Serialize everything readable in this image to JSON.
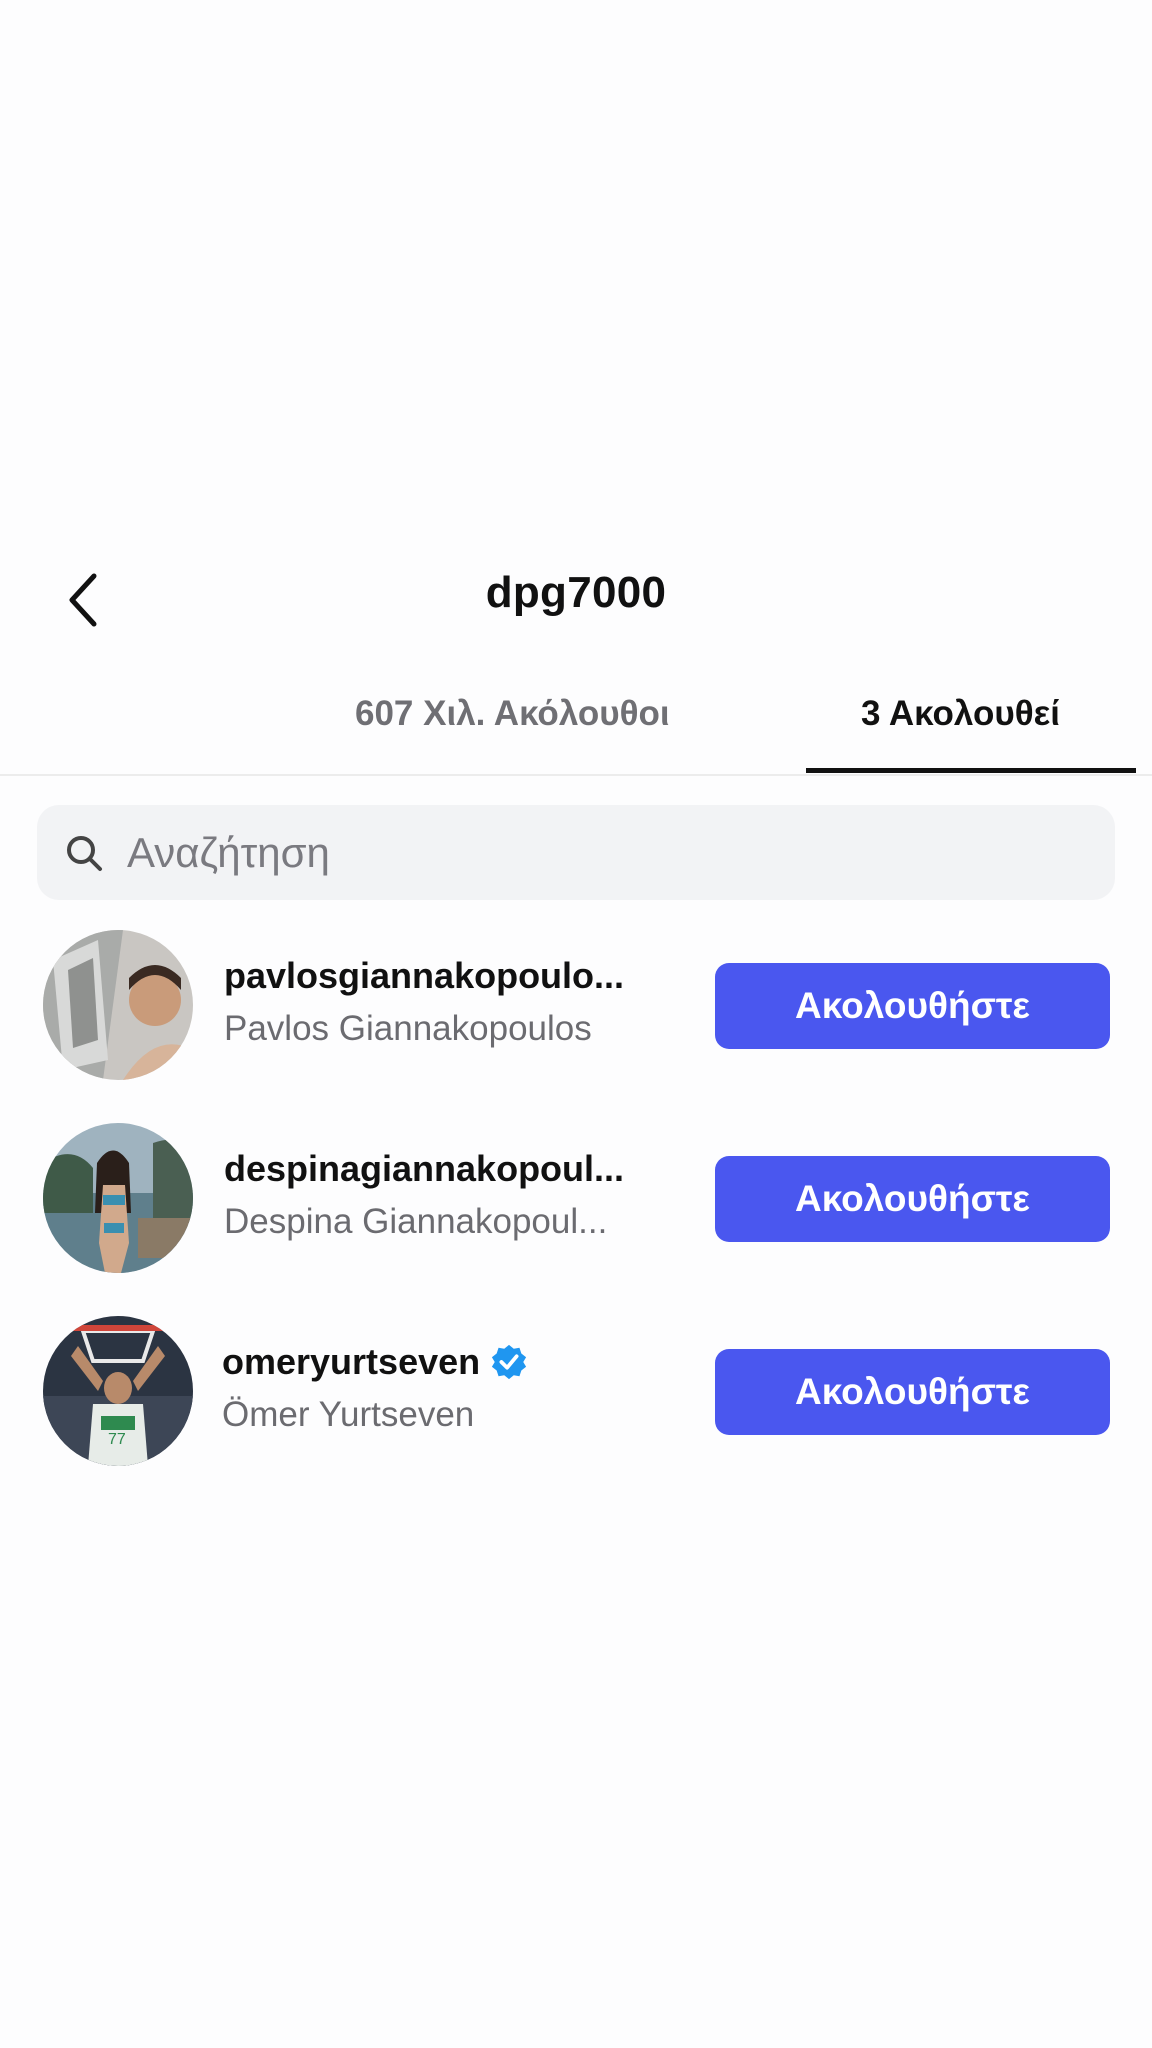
{
  "header": {
    "title": "dpg7000",
    "back_icon": "chevron-left-icon"
  },
  "tabs": [
    {
      "label": "607 Χιλ. Ακόλουθοι",
      "active": false
    },
    {
      "label": "3 Ακολουθεί",
      "active": true
    }
  ],
  "search": {
    "placeholder": "Αναζήτηση",
    "value": "",
    "icon": "search-icon"
  },
  "accounts": [
    {
      "username": "pavlosgiannakopoulo...",
      "full_name": "Pavlos Giannakopoulos",
      "verified": false,
      "button_label": "Ακολουθήστε"
    },
    {
      "username": "despinagiannakopoul...",
      "full_name": "Despina Giannakopoul...",
      "verified": false,
      "button_label": "Ακολουθήστε"
    },
    {
      "username": "omeryurtseven",
      "full_name": "Ömer Yurtseven",
      "verified": true,
      "button_label": "Ακολουθήστε"
    }
  ],
  "colors": {
    "accent": "#4a57ef",
    "verified": "#1f96f0",
    "muted_text": "#6b6b70",
    "search_bg": "#f2f3f5"
  }
}
